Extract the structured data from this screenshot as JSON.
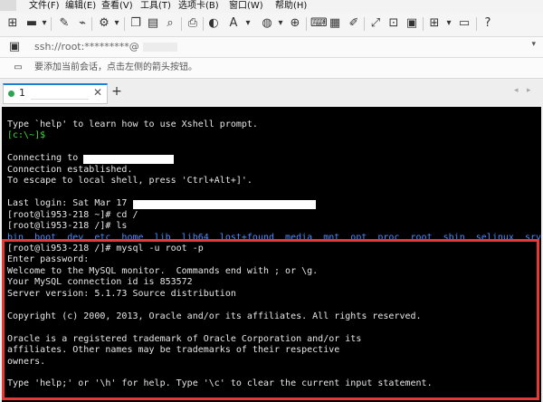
{
  "menu": {
    "items": [
      "文件(F)",
      "编辑(E)",
      "查看(V)",
      "工具(T)",
      "选项卡(B)",
      "窗口(W)",
      "帮助(H)"
    ]
  },
  "address": {
    "value": "ssh://root:*********@"
  },
  "hint": {
    "text": "要添加当前会话，点击左侧的箭头按钮。"
  },
  "tab": {
    "number": "1",
    "close": "✕",
    "new_tab": "+"
  },
  "terminal": {
    "lines": [
      "Type `help' to learn how to use Xshell prompt.",
      "[c:\\~]$",
      "",
      "Connecting to ",
      "Connection established.",
      "To escape to local shell, press 'Ctrl+Alt+]'.",
      "",
      "Last login: Sat Mar 17 ",
      "[root@li953-218 ~]# cd /",
      "[root@li953-218 /]# ls",
      "bin  boot  dev  etc  home  lib  lib64  lost+found  media  mnt  opt  proc  root  sbin  selinux  srv",
      "[root@li953-218 /]# mysql -u root -p",
      "Enter password:",
      "Welcome to the MySQL monitor.  Commands end with ; or \\g.",
      "Your MySQL connection id is 853572",
      "Server version: 5.1.73 Source distribution",
      "",
      "Copyright (c) 2000, 2013, Oracle and/or its affiliates. All rights reserved.",
      "",
      "Oracle is a registered trademark of Oracle Corporation and/or its",
      "affiliates. Other names may be trademarks of their respective",
      "owners.",
      "",
      "Type 'help;' or '\\h' for help. Type '\\c' to clear the current input statement."
    ]
  },
  "colors": {
    "highlight": "#e53935",
    "terminal_bg": "#000000",
    "prompt_green": "#3fdc3f",
    "ls_blue": "#4a8cff"
  },
  "icons": [
    "new-session-icon",
    "open-folder-icon",
    "pencil-icon",
    "settings-icon",
    "copy-icon",
    "paste-icon",
    "find-icon",
    "print-icon",
    "color-icon",
    "font-icon",
    "globe-icon",
    "lock-icon",
    "keyboard-icon",
    "compose-icon",
    "script-icon",
    "xftp-icon",
    "fullscreen-icon",
    "lock-screen-icon",
    "transparent-icon",
    "layout-icon",
    "add-icon",
    "comment-icon",
    "help-icon"
  ]
}
